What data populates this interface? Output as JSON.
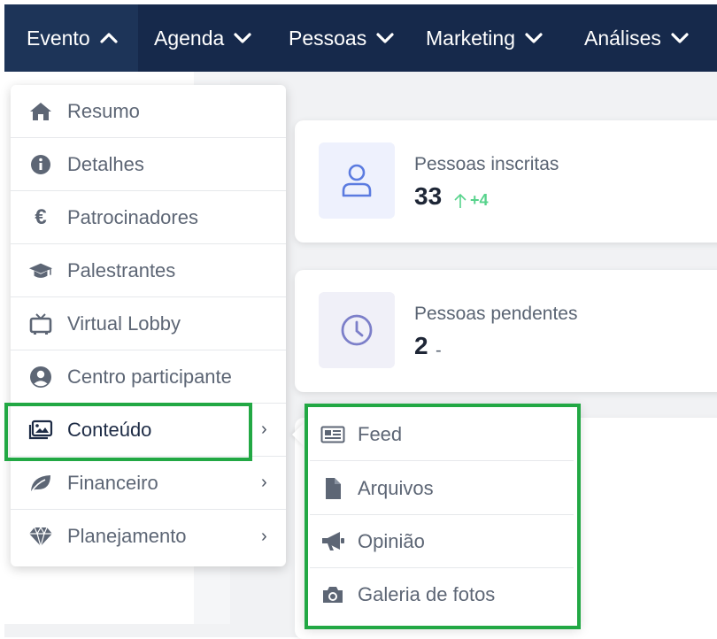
{
  "nav": {
    "items": [
      {
        "label": "Evento",
        "active": true
      },
      {
        "label": "Agenda"
      },
      {
        "label": "Pessoas"
      },
      {
        "label": "Marketing"
      },
      {
        "label": "Análises"
      }
    ]
  },
  "stats": [
    {
      "label": "Pessoas inscritas",
      "value": "33",
      "delta": "+4",
      "icon": "user-icon"
    },
    {
      "label": "Pessoas pendentes",
      "value": "2",
      "delta": "-",
      "icon": "clock-icon"
    }
  ],
  "menu": {
    "items": [
      {
        "label": "Resumo",
        "icon": "home-icon"
      },
      {
        "label": "Detalhes",
        "icon": "info-icon"
      },
      {
        "label": "Patrocinadores",
        "icon": "euro-icon"
      },
      {
        "label": "Palestrantes",
        "icon": "graduation-cap-icon"
      },
      {
        "label": "Virtual Lobby",
        "icon": "tv-icon"
      },
      {
        "label": "Centro participante",
        "icon": "user-circle-icon"
      },
      {
        "label": "Conteúdo",
        "icon": "images-icon",
        "has_submenu": true,
        "highlighted": true
      },
      {
        "label": "Financeiro",
        "icon": "leaf-icon",
        "has_submenu": true
      },
      {
        "label": "Planejamento",
        "icon": "gem-icon",
        "has_submenu": true
      }
    ],
    "chevron": "›"
  },
  "submenu": {
    "items": [
      {
        "label": "Feed",
        "icon": "newspaper-icon"
      },
      {
        "label": "Arquivos",
        "icon": "file-icon"
      },
      {
        "label": "Opinião",
        "icon": "bullhorn-icon"
      },
      {
        "label": "Galeria de fotos",
        "icon": "camera-icon"
      }
    ]
  },
  "colors": {
    "nav_bg": "#16294b",
    "highlight_border": "#22a844",
    "delta_positive": "#57d38c",
    "stat_icon_blue": "#5b7be0",
    "stat_icon_purple": "#7c7fc9"
  }
}
